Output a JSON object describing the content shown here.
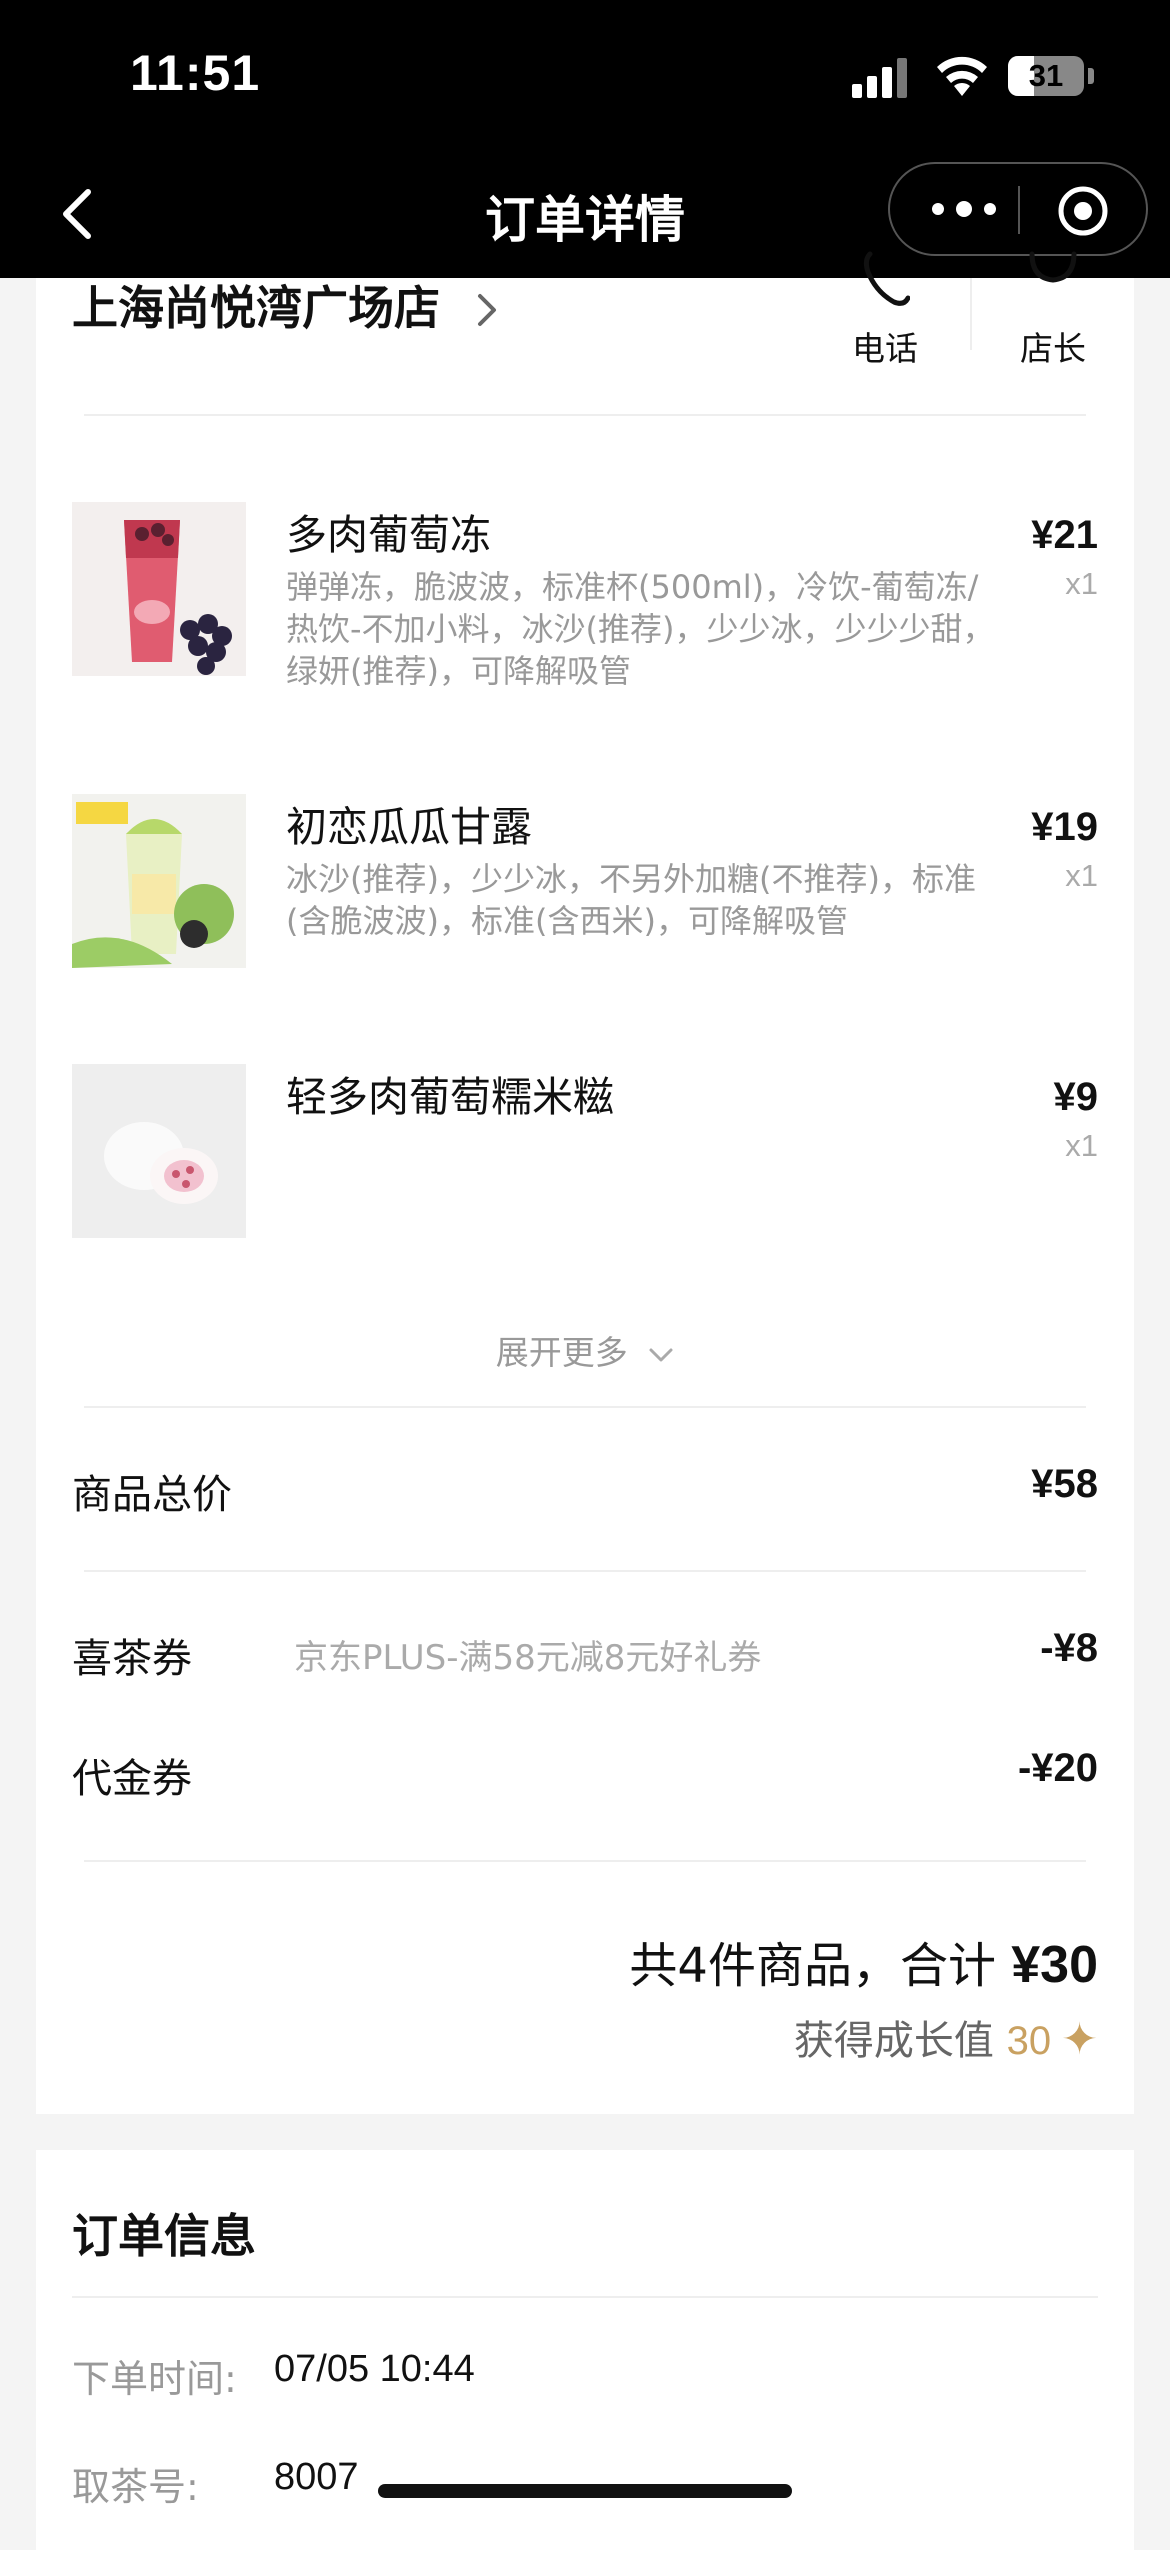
{
  "status_bar": {
    "time": "11:51",
    "battery": "31"
  },
  "nav": {
    "title": "订单详情"
  },
  "store": {
    "name": "上海尚悦湾广场店",
    "phone_label": "电话",
    "manager_label": "店长"
  },
  "items": [
    {
      "name": "多肉葡萄冻",
      "desc": "弹弹冻，脆波波，标准杯(500ml)，冷饮-葡萄冻/热饮-不加小料，冰沙(推荐)，少少冰，少少少甜，绿妍(推荐)，可降解吸管",
      "price": "¥21",
      "qty": "x1"
    },
    {
      "name": "初恋瓜瓜甘露",
      "desc": "冰沙(推荐)，少少冰，不另外加糖(不推荐)，标准(含脆波波)，标准(含西米)，可降解吸管",
      "price": "¥19",
      "qty": "x1"
    },
    {
      "name": "轻多肉葡萄糯米糍",
      "desc": "",
      "price": "¥9",
      "qty": "x1"
    }
  ],
  "expand_label": "展开更多",
  "summary": {
    "goods_total_label": "商品总价",
    "goods_total_value": "¥58",
    "coupon_label": "喜茶券",
    "coupon_desc": "京东PLUS-满58元减8元好礼券",
    "coupon_value": "-¥8",
    "voucher_label": "代金券",
    "voucher_value": "-¥20",
    "total_prefix": "共4件商品，合计",
    "total_amount": "¥30",
    "growth_label": "获得成长值",
    "growth_value": "30"
  },
  "order_info": {
    "title": "订单信息",
    "time_label": "下单时间:",
    "time_value": "07/05 10:44",
    "pickup_label": "取茶号:",
    "pickup_value": "8007"
  },
  "colors": {
    "accent_gold": "#c9a161",
    "header_bg": "#000000"
  }
}
